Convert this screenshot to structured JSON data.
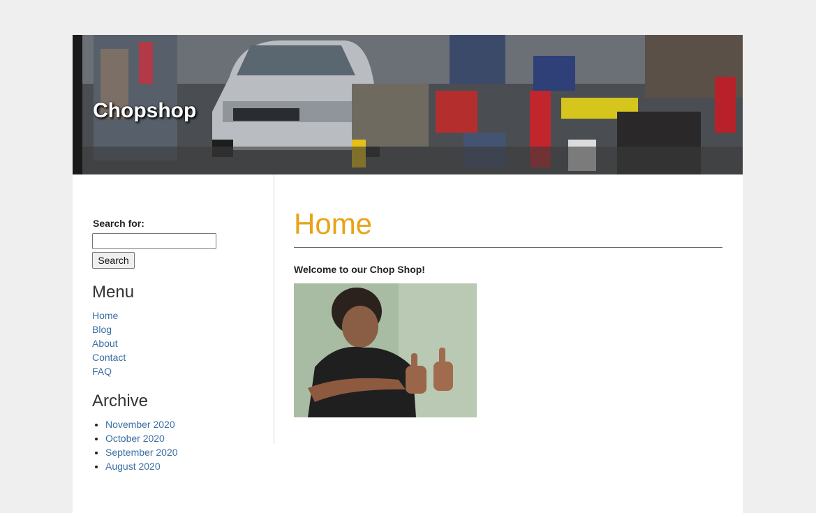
{
  "site": {
    "title": "Chopshop"
  },
  "search": {
    "label": "Search for:",
    "placeholder": "",
    "value": "",
    "button_label": "Search"
  },
  "menu": {
    "title": "Menu",
    "items": [
      {
        "label": "Home"
      },
      {
        "label": "Blog"
      },
      {
        "label": "About"
      },
      {
        "label": "Contact"
      },
      {
        "label": "FAQ"
      }
    ]
  },
  "archive": {
    "title": "Archive",
    "items": [
      {
        "label": "November 2020"
      },
      {
        "label": "October 2020"
      },
      {
        "label": "September 2020"
      },
      {
        "label": "August 2020"
      }
    ]
  },
  "main": {
    "heading": "Home",
    "welcome": "Welcome to our Chop Shop!"
  },
  "colors": {
    "heading": "#e8a317",
    "link": "#3a6ea5",
    "background": "#efefef"
  }
}
